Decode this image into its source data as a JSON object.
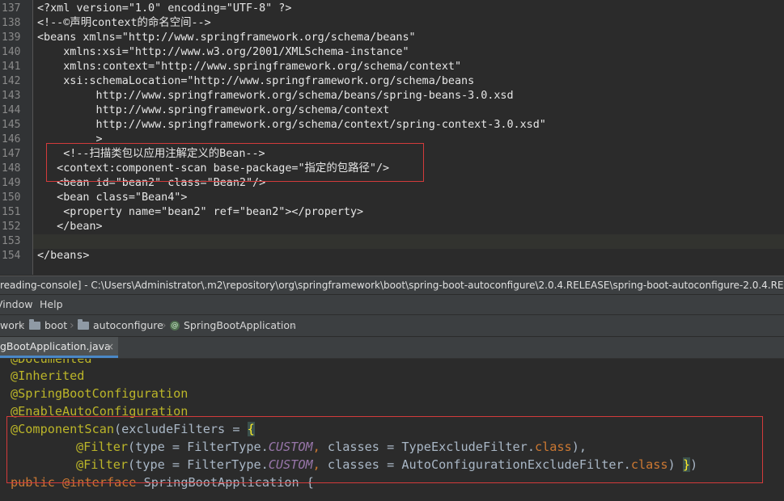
{
  "xml_editor": {
    "line_numbers": [
      "137",
      "138",
      "139",
      "140",
      "141",
      "142",
      "143",
      "144",
      "145",
      "146",
      "147",
      "148",
      "149",
      "150",
      "151",
      "152",
      "153",
      "154"
    ],
    "lines": [
      "<?xml version=\"1.0\" encoding=\"UTF-8\" ?>",
      "<!--©声明context的命名空间-->",
      "<beans xmlns=\"http://www.springframework.org/schema/beans\"",
      "    xmlns:xsi=\"http://www.w3.org/2001/XMLSchema-instance\"",
      "    xmlns:context=\"http://www.springframework.org/schema/context\"",
      "    xsi:schemaLocation=\"http://www.springframework.org/schema/beans",
      "         http://www.springframework.org/schema/beans/spring-beans-3.0.xsd",
      "         http://www.springframework.org/schema/context",
      "         http://www.springframework.org/schema/context/spring-context-3.0.xsd\"",
      "         >",
      "    <!--扫描类包以应用注解定义的Bean-->",
      "   <context:component-scan base-package=\"指定的包路径\"/>",
      "   <bean id=\"bean2\" class=\"Bean2\"/>",
      "   <bean class=\"Bean4\">",
      "    <property name=\"bean2\" ref=\"bean2\"></property>",
      "   </bean>",
      "",
      "</beans>"
    ]
  },
  "window": {
    "title": "reading-console] - C:\\Users\\Administrator\\.m2\\repository\\org\\springframework\\boot\\spring-boot-autoconfigure\\2.0.4.RELEASE\\spring-boot-autoconfigure-2.0.4.RELEA"
  },
  "menu": {
    "items": [
      "Vindow",
      "Help"
    ]
  },
  "breadcrumb": {
    "items": [
      "work",
      "boot",
      "autoconfigure",
      "SpringBootApplication"
    ]
  },
  "tab": {
    "label": "gBootApplication.java",
    "close": "×"
  },
  "java_editor": {
    "ann_documented": "@Documented",
    "ann_inherited": "@Inherited",
    "ann_sbc": "@SpringBootConfiguration",
    "ann_eac": "@EnableAutoConfiguration",
    "cs_ann": "@ComponentScan",
    "cs_open": "(excludeFilters = ",
    "cs_brace": "{",
    "filter_ann": "@Filter",
    "filter_type": "(type = FilterType.",
    "custom": "CUSTOM",
    "comma": ",",
    "classes": " classes = ",
    "f1_class": "TypeExcludeFilter.",
    "f2_class": "AutoConfigurationExcludeFilter.",
    "class_kw": "class",
    "f1_tail": "),",
    "f2_tail": ") ",
    "close_brace": "}",
    "close_paren": ")",
    "public_kw": "public ",
    "iface_kw": "@interface ",
    "type_name": "SpringBootApplication ",
    "open_brace": "{"
  },
  "colors": {
    "annotation": "#bbb529",
    "keyword": "#cc7832",
    "highlight_box": "#d33b3b",
    "tab_underline": "#4a88c7"
  }
}
